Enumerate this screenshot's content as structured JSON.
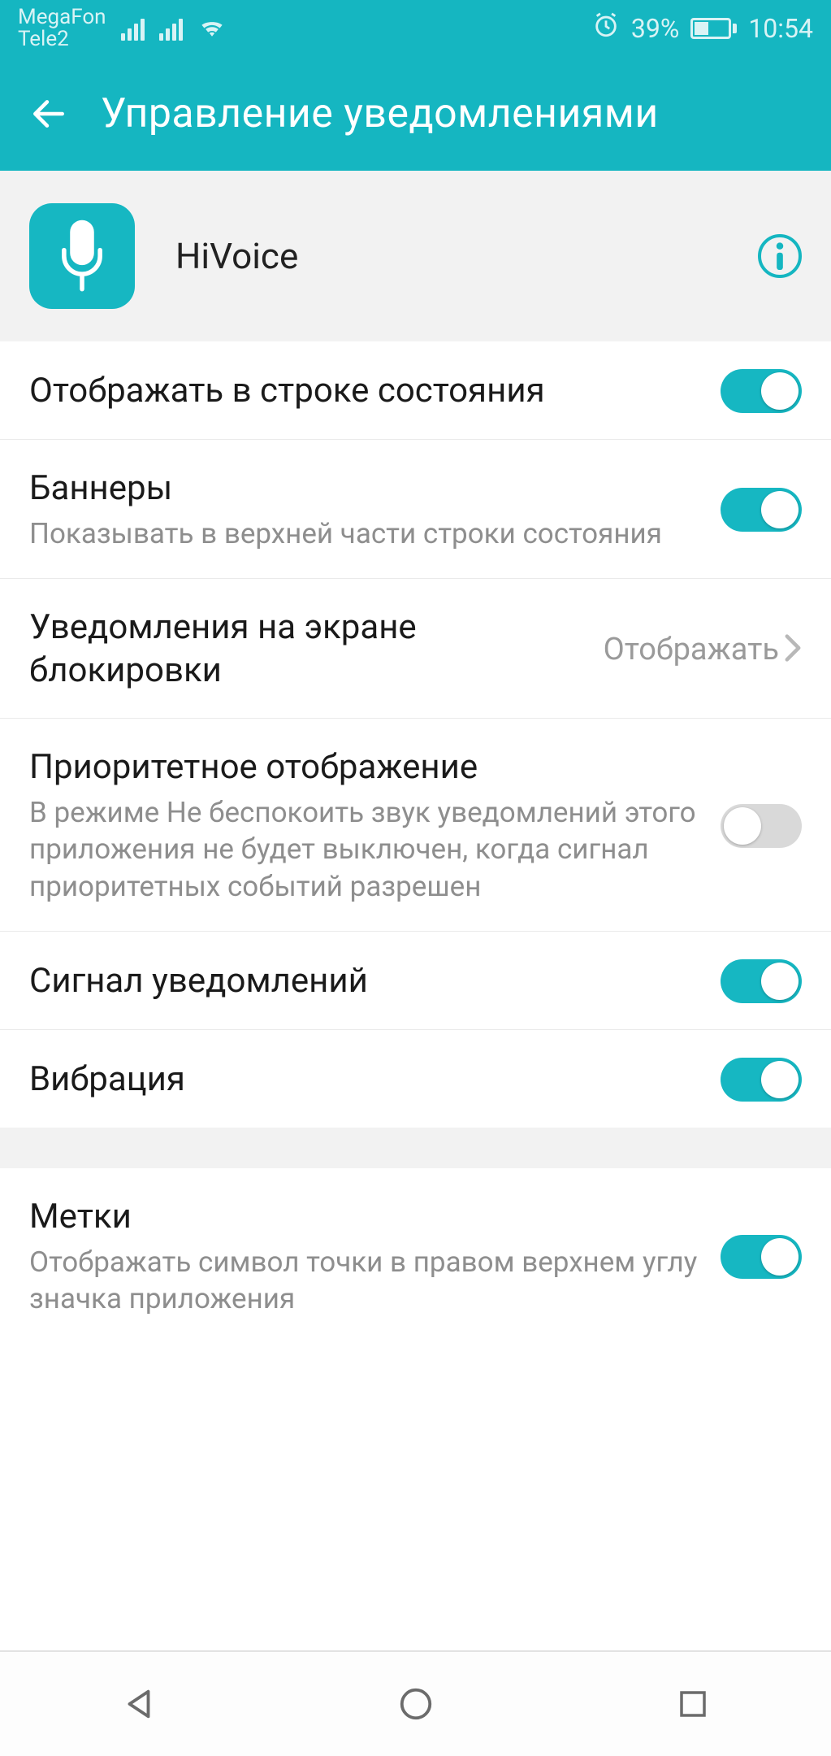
{
  "status": {
    "carrier1": "MegaFon",
    "carrier2": "Tele2",
    "battery_percent": "39%",
    "time": "10:54"
  },
  "appbar": {
    "title": "Управление уведомлениями"
  },
  "app": {
    "name": "HiVoice"
  },
  "rows": {
    "status_bar": {
      "title": "Отображать в строке состояния",
      "on": true
    },
    "banners": {
      "title": "Баннеры",
      "sub": "Показывать в верхней части строки состояния",
      "on": true
    },
    "lockscreen": {
      "title": "Уведомления на экране блокировки",
      "value": "Отображать"
    },
    "priority": {
      "title": "Приоритетное отображение",
      "sub": "В режиме Не беспокоить звук уведомлений этого приложения не будет выключен, когда сигнал приоритетных событий разрешен",
      "on": false
    },
    "sound": {
      "title": "Сигнал уведомлений",
      "on": true
    },
    "vibration": {
      "title": "Вибрация",
      "on": true
    },
    "badges": {
      "title": "Метки",
      "sub": "Отображать символ точки в правом верхнем углу значка приложения",
      "on": true
    }
  }
}
